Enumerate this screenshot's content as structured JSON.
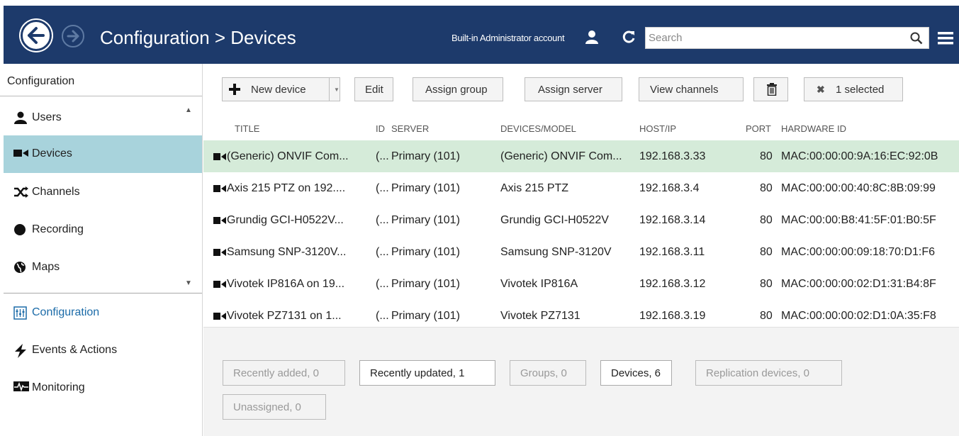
{
  "header": {
    "title": "Configuration > Devices",
    "account": "Built-in Administrator account",
    "search_placeholder": "Search",
    "back_icon": "back-arrow-icon",
    "forward_icon": "forward-arrow-icon",
    "bg_color": "#1d3a6b"
  },
  "sidebar": {
    "heading": "Configuration",
    "items": [
      {
        "label": "Users",
        "icon": "user-icon"
      },
      {
        "label": "Devices",
        "icon": "camera-icon",
        "active": true
      },
      {
        "label": "Channels",
        "icon": "shuffle-icon"
      },
      {
        "label": "Recording",
        "icon": "record-dot-icon"
      },
      {
        "label": "Maps",
        "icon": "globe-icon"
      }
    ],
    "sections": [
      {
        "label": "Configuration",
        "icon": "config-panel-icon",
        "current": true
      },
      {
        "label": "Events & Actions",
        "icon": "lightning-icon"
      },
      {
        "label": "Monitoring",
        "icon": "monitor-pulse-icon"
      }
    ],
    "active_color": "#a8d3dc"
  },
  "toolbar": {
    "new_device": "New device",
    "edit": "Edit",
    "assign_group": "Assign group",
    "assign_server": "Assign server",
    "view_channels": "View channels",
    "selected": "1 selected"
  },
  "table": {
    "columns": [
      "TITLE",
      "ID",
      "SERVER",
      "DEVICES/MODEL",
      "HOST/IP",
      "PORT",
      "HARDWARE ID"
    ],
    "rows": [
      {
        "title": "(Generic) ONVIF Com...",
        "id": "(...",
        "server": "Primary (101)",
        "model": "(Generic) ONVIF Com...",
        "host": "192.168.3.33",
        "port": "80",
        "hwid": "MAC:00:00:00:9A:16:EC:92:0B",
        "selected": true
      },
      {
        "title": "Axis 215 PTZ on 192....",
        "id": "(...",
        "server": "Primary (101)",
        "model": "Axis 215 PTZ",
        "host": "192.168.3.4",
        "port": "80",
        "hwid": "MAC:00:00:00:40:8C:8B:09:99"
      },
      {
        "title": "Grundig GCI-H0522V...",
        "id": "(...",
        "server": "Primary (101)",
        "model": "Grundig GCI-H0522V",
        "host": "192.168.3.14",
        "port": "80",
        "hwid": "MAC:00:00:B8:41:5F:01:B0:5F"
      },
      {
        "title": "Samsung SNP-3120V...",
        "id": "(...",
        "server": "Primary (101)",
        "model": "Samsung SNP-3120V",
        "host": "192.168.3.11",
        "port": "80",
        "hwid": "MAC:00:00:00:09:18:70:D1:F6"
      },
      {
        "title": "Vivotek IP816A on 19...",
        "id": "(...",
        "server": "Primary (101)",
        "model": "Vivotek IP816A",
        "host": "192.168.3.12",
        "port": "80",
        "hwid": "MAC:00:00:00:02:D1:31:B4:8F"
      },
      {
        "title": "Vivotek PZ7131 on 1...",
        "id": "(...",
        "server": "Primary (101)",
        "model": "Vivotek PZ7131",
        "host": "192.168.3.19",
        "port": "80",
        "hwid": "MAC:00:00:00:02:D1:0A:35:F8"
      }
    ],
    "selected_color": "#d5ebd9"
  },
  "filters": [
    {
      "label": "Recently added, 0",
      "active": false
    },
    {
      "label": "Recently updated, 1",
      "active": true
    },
    {
      "label": "Groups, 0",
      "active": false
    },
    {
      "label": "Devices, 6",
      "active": true
    },
    {
      "label": "Replication devices, 0",
      "active": false
    },
    {
      "label": "Unassigned, 0",
      "active": false
    }
  ]
}
